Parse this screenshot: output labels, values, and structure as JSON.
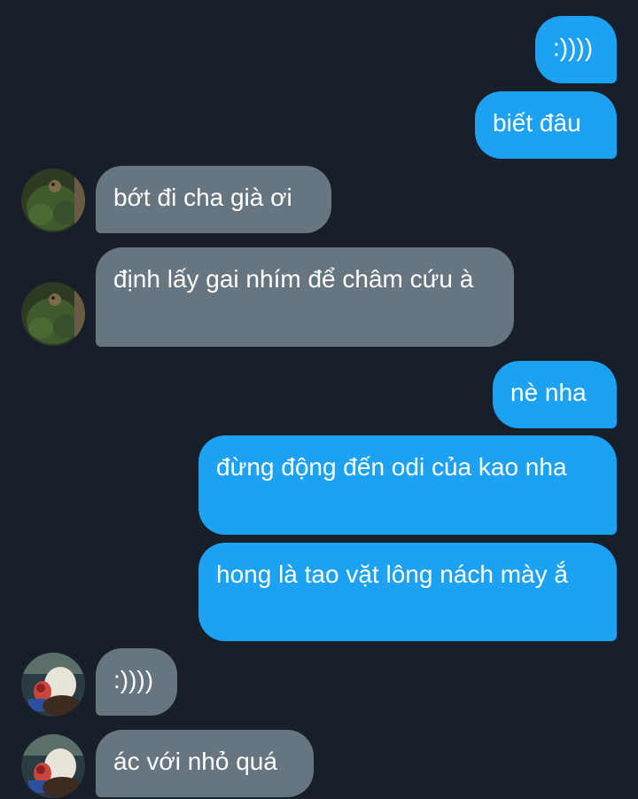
{
  "conversation": {
    "messages": [
      {
        "sender": "me",
        "text": ":))))"
      },
      {
        "sender": "me",
        "text": "biết đâu"
      },
      {
        "sender": "other-1",
        "text": "bớt đi cha già ơi"
      },
      {
        "sender": "other-1",
        "text": "định lấy gai nhím để châm cứu à"
      },
      {
        "sender": "me",
        "text": "nè nha"
      },
      {
        "sender": "me",
        "text": "đừng động đến odi của kao nha"
      },
      {
        "sender": "me",
        "text": "hong là tao vặt lông nách mày ắ"
      },
      {
        "sender": "other-2",
        "text": ":))))"
      },
      {
        "sender": "other-2",
        "text": "ác với nhỏ quá"
      }
    ]
  },
  "colors": {
    "background": "#17202a",
    "outgoing_bubble": "#1da1f2",
    "incoming_bubble": "#66757f",
    "text": "#ffffff"
  }
}
